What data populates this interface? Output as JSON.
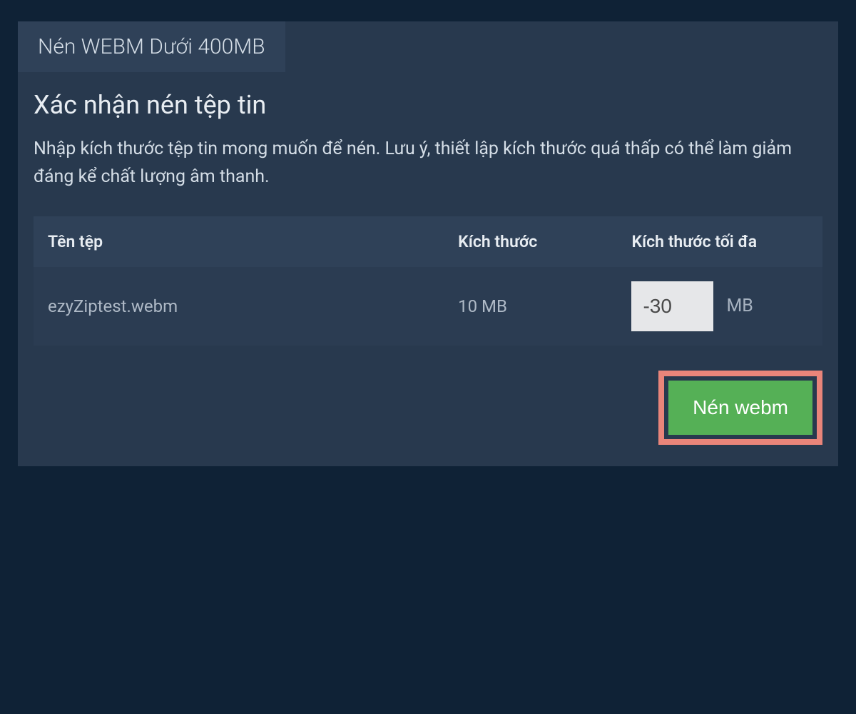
{
  "tab": {
    "label": "Nén WEBM Dưới 400MB"
  },
  "panel": {
    "title": "Xác nhận nén tệp tin",
    "description": "Nhập kích thước tệp tin mong muốn để nén. Lưu ý, thiết lập kích thước quá thấp có thể làm giảm đáng kể chất lượng âm thanh."
  },
  "table": {
    "headers": {
      "filename": "Tên tệp",
      "size": "Kích thước",
      "maxsize": "Kích thước tối đa"
    },
    "rows": [
      {
        "filename": "ezyZiptest.webm",
        "size": "10 MB",
        "maxsize_value": "-30",
        "maxsize_unit": "MB"
      }
    ]
  },
  "actions": {
    "compress_label": "Nén webm"
  }
}
